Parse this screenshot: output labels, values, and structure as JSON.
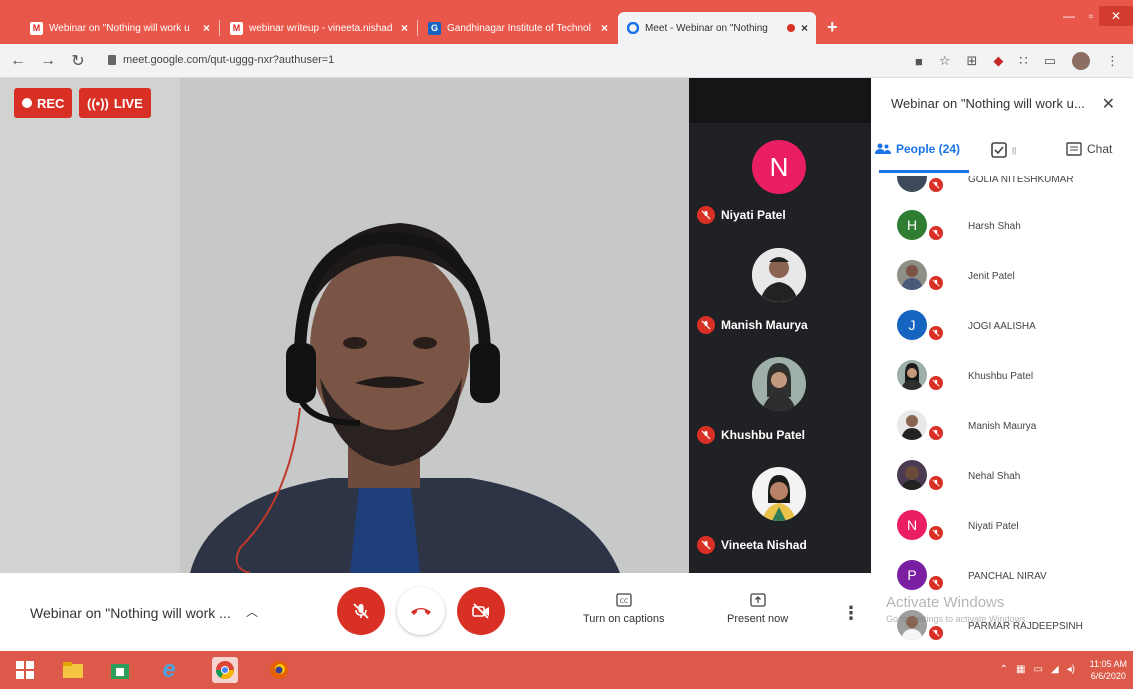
{
  "browser": {
    "tabs": [
      {
        "title": "Webinar on \"Nothing will work u",
        "icon": "gmail-icon",
        "active": false
      },
      {
        "title": "webinar writeup - vineeta.nishad",
        "icon": "gmail-icon",
        "active": false
      },
      {
        "title": "Gandhinagar Institute of Technol",
        "icon": "college-icon",
        "active": false
      },
      {
        "title": "Meet - Webinar on \"Nothing",
        "icon": "meet-icon",
        "active": true
      }
    ],
    "new_tab": "+",
    "url": "meet.google.com/qut-uggg-nxr?authuser=1"
  },
  "recording": {
    "rec_label": "REC",
    "live_label": "LIVE"
  },
  "tiles": [
    {
      "name": "Niyati Patel",
      "avatar_letter": "N",
      "avatar_color": "#e91e63"
    },
    {
      "name": "Manish Maurya"
    },
    {
      "name": "Khushbu Patel"
    },
    {
      "name": "Vineeta Nishad"
    }
  ],
  "panel": {
    "title": "Webinar on \"Nothing will work u...",
    "tabs": {
      "people": "People (24)",
      "chat": "Chat",
      "activities_badge": "||"
    },
    "people": [
      {
        "name": "GOLIA NITESHKUMAR",
        "type": "photo"
      },
      {
        "name": "Harsh Shah",
        "letter": "H",
        "color": "#2e7d32"
      },
      {
        "name": "Jenit Patel",
        "type": "photo"
      },
      {
        "name": "JOGI AALISHA",
        "letter": "J",
        "color": "#1565c0"
      },
      {
        "name": "Khushbu Patel",
        "type": "photo"
      },
      {
        "name": "Manish Maurya",
        "type": "photo"
      },
      {
        "name": "Nehal Shah",
        "type": "photo"
      },
      {
        "name": "Niyati Patel",
        "letter": "N",
        "color": "#e91e63"
      },
      {
        "name": "PANCHAL NIRAV",
        "letter": "P",
        "color": "#7b1fa2"
      },
      {
        "name": "PARMAR RAJDEEPSINH",
        "type": "photo"
      }
    ],
    "watermark_title": "Activate Windows",
    "watermark_sub": "Go to Settings to activate Windows."
  },
  "controls": {
    "meeting_title": "Webinar on \"Nothing will work ...",
    "captions_label": "Turn on captions",
    "present_label": "Present now"
  },
  "taskbar": {
    "time": "11:05 AM",
    "date": "6/6/2020"
  },
  "colors": {
    "accent_red": "#d93025",
    "meet_blue": "#1a73e8",
    "window_frame": "#e9574a"
  }
}
